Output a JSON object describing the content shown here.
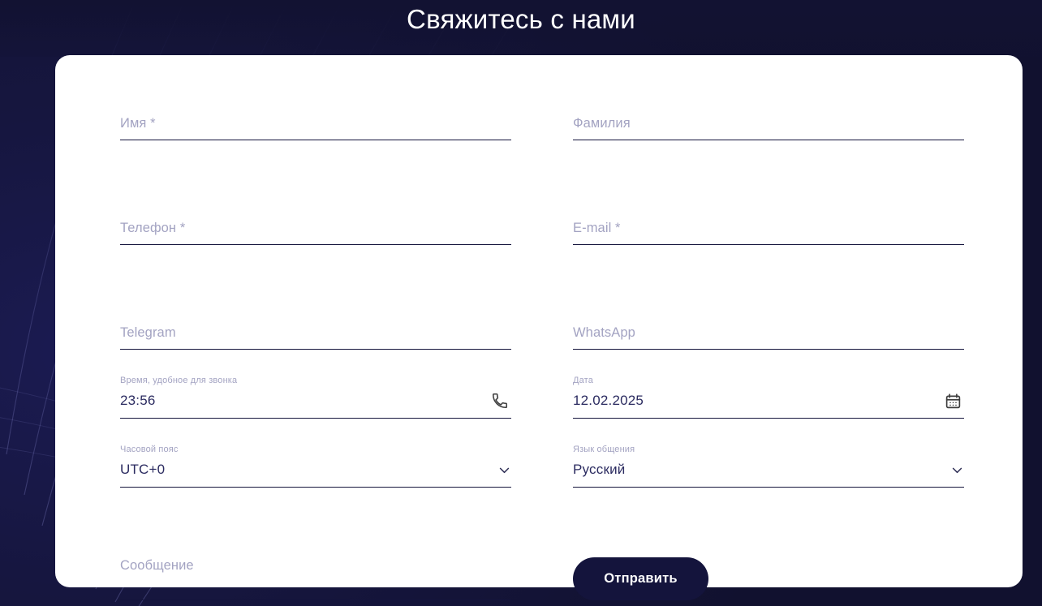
{
  "page": {
    "title": "Свяжитесь с нами",
    "background_color": "#131338",
    "card_background": "#ffffff",
    "accent_color": "#14143c",
    "placeholder_color": "#a3a3c2",
    "value_color": "#2b2b60"
  },
  "form": {
    "rows": [
      {
        "left": {
          "type": "placeholder",
          "name": "first-name",
          "placeholder": "Имя *"
        },
        "right": {
          "type": "placeholder",
          "name": "last-name",
          "placeholder": "Фамилия"
        }
      },
      {
        "left": {
          "type": "placeholder",
          "name": "phone",
          "placeholder": "Телефон *"
        },
        "right": {
          "type": "placeholder",
          "name": "email",
          "placeholder": "E-mail *"
        }
      },
      {
        "left": {
          "type": "placeholder",
          "name": "telegram",
          "placeholder": "Telegram"
        },
        "right": {
          "type": "placeholder",
          "name": "whatsapp",
          "placeholder": "WhatsApp"
        }
      },
      {
        "left": {
          "type": "value",
          "name": "call-time",
          "label": "Время, удобное для звонка",
          "value": "23:56",
          "icon": "phone-icon"
        },
        "right": {
          "type": "value",
          "name": "date",
          "label": "Дата",
          "value": "12.02.2025",
          "icon": "calendar-icon"
        }
      },
      {
        "left": {
          "type": "select",
          "name": "timezone",
          "label": "Часовой пояс",
          "value": "UTC+0",
          "icon": "chevron-down-icon"
        },
        "right": {
          "type": "select",
          "name": "language",
          "label": "Язык общения",
          "value": "Русский",
          "icon": "chevron-down-icon"
        }
      }
    ],
    "message": {
      "placeholder": "Сообщение"
    },
    "submit": {
      "label": "Отправить"
    }
  },
  "fields": {
    "first_name_placeholder": "Имя *",
    "last_name_placeholder": "Фамилия",
    "phone_placeholder": "Телефон *",
    "email_placeholder": "E-mail *",
    "telegram_placeholder": "Telegram",
    "whatsapp_placeholder": "WhatsApp",
    "call_time_label": "Время, удобное для звонка",
    "call_time_value": "23:56",
    "date_label": "Дата",
    "date_value": "12.02.2025",
    "timezone_label": "Часовой пояс",
    "timezone_value": "UTC+0",
    "language_label": "Язык общения",
    "language_value": "Русский",
    "message_placeholder": "Сообщение",
    "submit_label": "Отправить"
  }
}
